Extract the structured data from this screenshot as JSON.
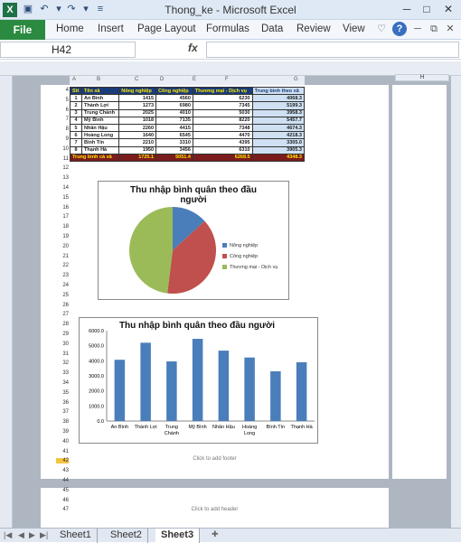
{
  "window": {
    "title": "Thong_ke  -  Microsoft Excel"
  },
  "ribbon": {
    "tabs": [
      "File",
      "Home",
      "Insert",
      "Page Layout",
      "Formulas",
      "Data",
      "Review",
      "View"
    ]
  },
  "formula_bar": {
    "cell_ref": "H42",
    "fx": "fx"
  },
  "columns": [
    "A",
    "B",
    "C",
    "D",
    "E",
    "F",
    "G"
  ],
  "col_h": "H",
  "table": {
    "headers": [
      "Stt",
      "Tên xã",
      "Nông nghiệp",
      "Công nghiệp",
      "Thương mại - Dịch vụ",
      "Trung bình theo xã"
    ],
    "rows": [
      [
        "1",
        "An Bình",
        "1415",
        "4560",
        "6230",
        "4068.3"
      ],
      [
        "2",
        "Thành Lợi",
        "1273",
        "6980",
        "7345",
        "5199.3"
      ],
      [
        "3",
        "Trung Chánh",
        "2025",
        "4010",
        "5030",
        "3958.3"
      ],
      [
        "4",
        "Mỹ Bình",
        "1018",
        "7135",
        "8220",
        "5457.7"
      ],
      [
        "5",
        "Nhân Hậu",
        "2260",
        "4415",
        "7348",
        "4674.3"
      ],
      [
        "6",
        "Hoàng Long",
        "1640",
        "6545",
        "4470",
        "4218.3"
      ],
      [
        "7",
        "Bình Tín",
        "2210",
        "3310",
        "4395",
        "3305.0"
      ],
      [
        "8",
        "Thạnh Hà",
        "1950",
        "3456",
        "6310",
        "3905.3"
      ]
    ],
    "avg": [
      "Trung bình cả xã",
      "",
      "1725.1",
      "5051.4",
      "6268.5",
      "4348.3"
    ]
  },
  "row_numbers": [
    "4",
    "5",
    "6",
    "7",
    "8",
    "9",
    "10",
    "11",
    "12",
    "13",
    "14",
    "15",
    "16",
    "17",
    "18",
    "19",
    "20",
    "21",
    "22",
    "23",
    "24",
    "25",
    "26",
    "27",
    "28",
    "29",
    "30",
    "31",
    "32",
    "33",
    "34",
    "35",
    "36",
    "37",
    "38",
    "39",
    "40",
    "41",
    "42",
    "43",
    "44",
    "45",
    "46",
    "47"
  ],
  "chart_data": [
    {
      "type": "pie",
      "title": "Thu nhập bình quân theo đầu người",
      "categories": [
        "Nông nghiệp",
        "Công nghiệp",
        "Thương mại - Dịch vụ"
      ],
      "values": [
        1725.1,
        5051.4,
        6268.5
      ],
      "colors": [
        "#4a7ebb",
        "#c0504d",
        "#9bbb59"
      ]
    },
    {
      "type": "bar",
      "title": "Thu nhập bình quân theo đầu người",
      "categories": [
        "An Bình",
        "Thành Lợi",
        "Trung Chánh",
        "Mỹ Bình",
        "Nhân Hậu",
        "Hoàng Long",
        "Bình Tín",
        "Thạnh Hà"
      ],
      "values": [
        4068.3,
        5199.3,
        3958.3,
        5457.7,
        4674.3,
        4218.3,
        3305.0,
        3905.3
      ],
      "ylim": [
        0,
        6000
      ],
      "yticks": [
        "0.0",
        "1000.0",
        "2000.0",
        "3000.0",
        "4000.0",
        "5000.0",
        "6000.0"
      ],
      "color": "#4a7ebb"
    }
  ],
  "page": {
    "footer_tip": "Click to add footer",
    "header_tip": "Click to add header"
  },
  "sheets": [
    "Sheet1",
    "Sheet2",
    "Sheet3"
  ],
  "active_sheet": "Sheet3"
}
